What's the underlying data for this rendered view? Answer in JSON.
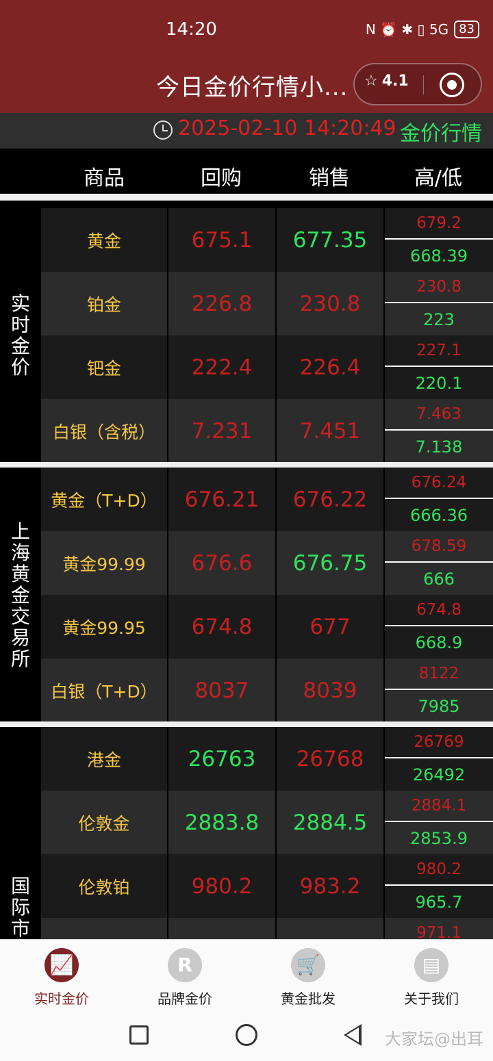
{
  "status": {
    "time": "14:20",
    "icons": "N ⏰ ✱ ▯ 5G",
    "battery": "83"
  },
  "titlebar": {
    "title": "今日金价行情小...",
    "rating": "4.1"
  },
  "timebar": {
    "datetime": "2025-02-10 14:20:49",
    "label": "金价行情"
  },
  "header": {
    "product": "商品",
    "buy": "回购",
    "sell": "销售",
    "highlow": "高/低"
  },
  "sections": [
    {
      "label": "实时金价",
      "rows": [
        {
          "name": "黄金",
          "buy": "675.1",
          "sell": "677.35",
          "high": "679.2",
          "low": "668.39"
        },
        {
          "name": "铂金",
          "buy": "226.8",
          "sell": "230.8",
          "high": "230.8",
          "low": "223"
        },
        {
          "name": "钯金",
          "buy": "222.4",
          "sell": "226.4",
          "high": "227.1",
          "low": "220.1"
        },
        {
          "name": "白银（含税）",
          "buy": "7.231",
          "sell": "7.451",
          "high": "7.463",
          "low": "7.138"
        }
      ]
    },
    {
      "label": "上海黄金交易所",
      "rows": [
        {
          "name": "黄金（T+D）",
          "buy": "676.21",
          "sell": "676.22",
          "high": "676.24",
          "low": "666.36"
        },
        {
          "name": "黄金99.99",
          "buy": "676.6",
          "sell": "676.75",
          "high": "678.59",
          "low": "666"
        },
        {
          "name": "黄金99.95",
          "buy": "674.8",
          "sell": "677",
          "high": "674.8",
          "low": "668.9"
        },
        {
          "name": "白银（T+D）",
          "buy": "8037",
          "sell": "8039",
          "high": "8122",
          "low": "7985"
        }
      ]
    },
    {
      "label": "国际市",
      "rows": [
        {
          "name": "港金",
          "buy": "26763",
          "sell": "26768",
          "high": "26769",
          "low": "26492"
        },
        {
          "name": "伦敦金",
          "buy": "2883.8",
          "sell": "2884.5",
          "high": "2884.1",
          "low": "2853.9"
        },
        {
          "name": "伦敦铂",
          "buy": "980.2",
          "sell": "983.2",
          "high": "980.2",
          "low": "965.7"
        },
        {
          "name": "",
          "buy": "",
          "sell": "",
          "high": "971.1",
          "low": ""
        }
      ]
    }
  ],
  "nav": [
    {
      "label": "实时金价",
      "icon": "chart-icon",
      "glyph": "📈"
    },
    {
      "label": "品牌金价",
      "icon": "brand-r-icon",
      "glyph": "R"
    },
    {
      "label": "黄金批发",
      "icon": "cart-icon",
      "glyph": "🛒"
    },
    {
      "label": "关于我们",
      "icon": "document-icon",
      "glyph": "▤"
    }
  ],
  "watermark": "大家坛@出耳",
  "colors": {
    "brand": "#7f2424",
    "up": "#2ee35b",
    "down": "#c91f1f",
    "name": "#f5c542"
  }
}
